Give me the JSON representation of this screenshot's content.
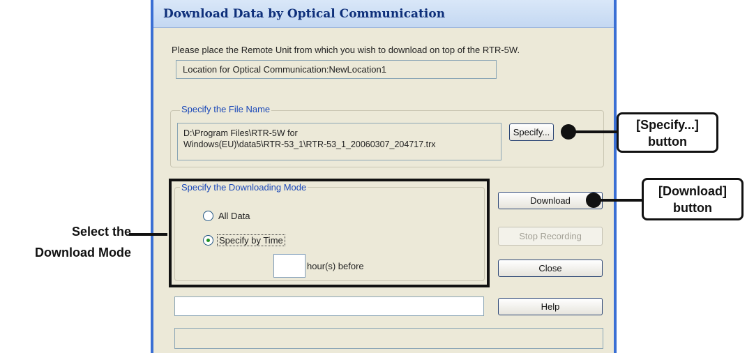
{
  "dialog": {
    "title": "Download Data by Optical Communication",
    "instruction": "Please place the Remote Unit from which you wish to download on top of the RTR-5W.",
    "location": "Location for Optical Communication:NewLocation1"
  },
  "file_group": {
    "legend": "Specify the File Name",
    "path_line1": "D:\\Program Files\\RTR-5W for",
    "path_line2": "Windows(EU)\\data5\\RTR-53_1\\RTR-53_1_20060307_204717.trx",
    "specify_button": "Specify..."
  },
  "mode_group": {
    "legend": "Specify the Downloading Mode",
    "option_all": "All Data",
    "option_time": "Specify by Time",
    "hours_value": "",
    "hours_suffix": "hour(s) before"
  },
  "buttons": {
    "download": "Download",
    "stop_recording": "Stop Recording",
    "close": "Close",
    "help": "Help"
  },
  "status_text": "",
  "annotations": {
    "specify_line1": "[Specify...]",
    "specify_line2": "button",
    "download_line1": "[Download]",
    "download_line2": "button",
    "mode_line1": "Select the",
    "mode_line2": "Download Mode"
  },
  "colors": {
    "title_text": "#0e2f7a",
    "window_border": "#3a6fd4",
    "legend_text": "#1a48b8",
    "radio_dot": "#1d9120"
  }
}
